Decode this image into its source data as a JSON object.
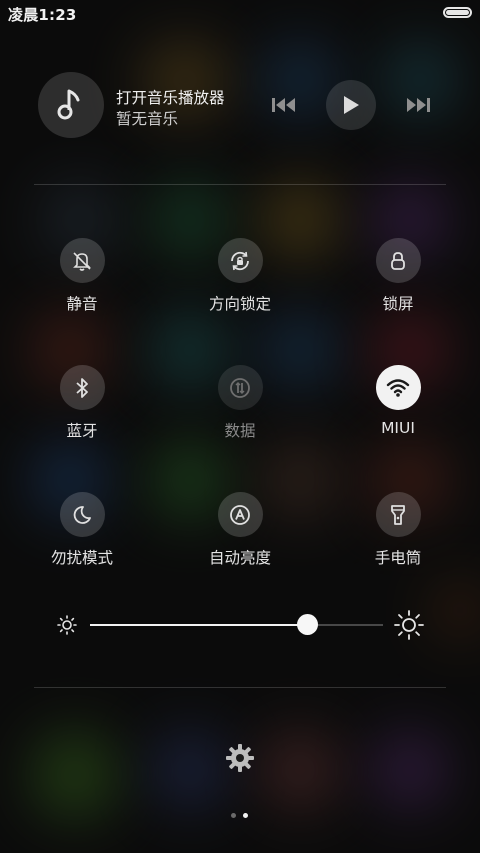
{
  "status_bar": {
    "time": "凌晨1:23"
  },
  "music": {
    "title": "打开音乐播放器",
    "subtitle": "暂无音乐",
    "icons": {
      "album": "music-note-icon",
      "prev": "previous-track-icon",
      "play": "play-icon",
      "next": "next-track-icon"
    }
  },
  "toggles": [
    {
      "label": "静音",
      "icon": "bell-off-icon",
      "active": false,
      "enabled": true
    },
    {
      "label": "方向锁定",
      "icon": "rotation-lock-icon",
      "active": false,
      "enabled": true
    },
    {
      "label": "锁屏",
      "icon": "lock-icon",
      "active": false,
      "enabled": true
    },
    {
      "label": "蓝牙",
      "icon": "bluetooth-icon",
      "active": false,
      "enabled": true
    },
    {
      "label": "数据",
      "icon": "mobile-data-icon",
      "active": false,
      "enabled": false
    },
    {
      "label": "MIUI",
      "icon": "wifi-icon",
      "active": true,
      "enabled": true
    },
    {
      "label": "勿扰模式",
      "icon": "moon-icon",
      "active": false,
      "enabled": true
    },
    {
      "label": "自动亮度",
      "icon": "auto-brightness-icon",
      "active": false,
      "enabled": true
    },
    {
      "label": "手电筒",
      "icon": "flashlight-icon",
      "active": false,
      "enabled": true
    }
  ],
  "brightness": {
    "level": 0.74,
    "icons": {
      "low": "brightness-low-icon",
      "high": "brightness-high-icon"
    }
  },
  "settings": {
    "icon": "settings-gear-icon"
  },
  "pagination": {
    "total": 2,
    "current": 2
  },
  "colors": {
    "active_toggle_bg": "#f2f2f2",
    "active_toggle_icon": "#1a1a1a",
    "inactive_toggle_bg": "#3a3a3a",
    "slider_fill": "#f2f2f2"
  }
}
